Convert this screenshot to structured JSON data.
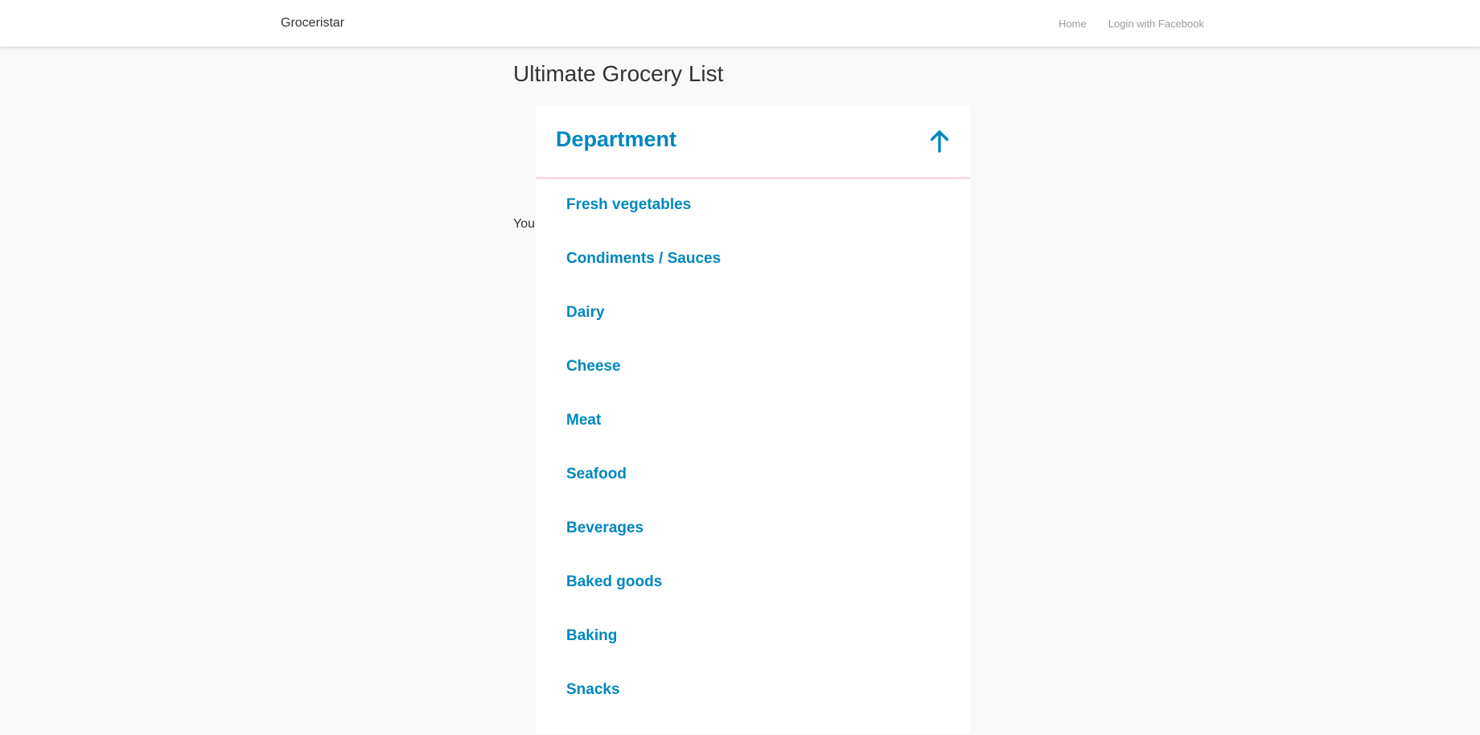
{
  "navbar": {
    "brand": "Groceristar",
    "links": [
      "Home",
      "Login with Facebook"
    ]
  },
  "main": {
    "title": "Ultimate Grocery List",
    "intro_text": "You"
  },
  "department_dropdown": {
    "title": "Department",
    "toggle_icon": "arrow-up-icon",
    "items": [
      "Fresh vegetables",
      "Condiments / Sauces",
      "Dairy",
      "Cheese",
      "Meat",
      "Seafood",
      "Beverages",
      "Baked goods",
      "Baking",
      "Snacks"
    ]
  },
  "colors": {
    "accent": "#0087c0",
    "divider": "#f7dce4",
    "page_background": "#f9f9f9",
    "nav_link": "#9a9a9a",
    "text": "#333333"
  }
}
